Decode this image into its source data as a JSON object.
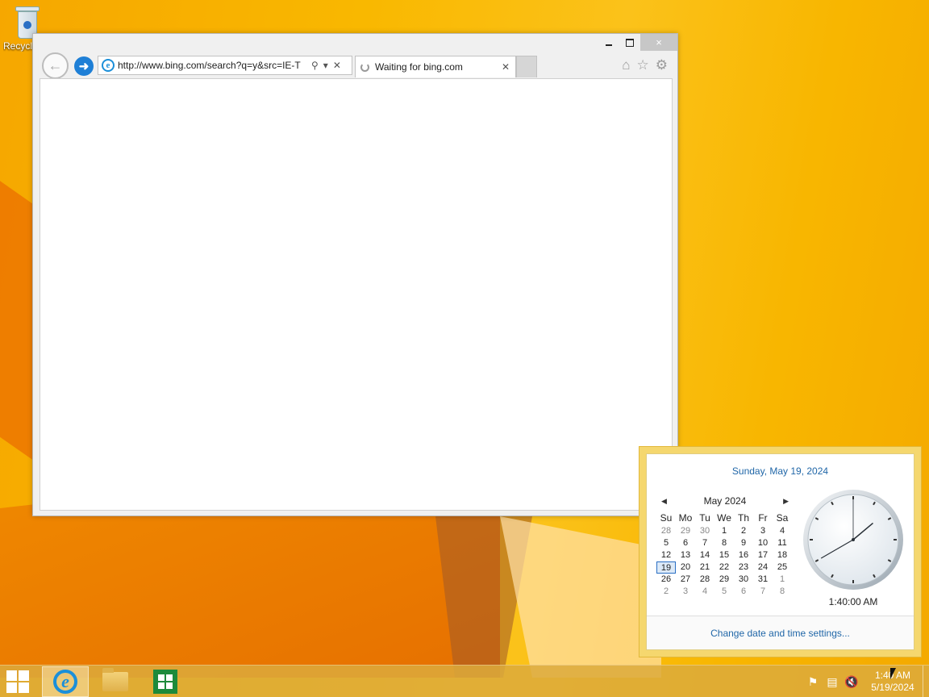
{
  "desktop": {
    "recycle_bin_label": "Recycle Bin"
  },
  "browser": {
    "address_url": "http://www.bing.com/search?q=y&src=IE-T",
    "tab_title": "Waiting for bing.com",
    "caption": {
      "minimize": "",
      "maximize": "",
      "close": "×"
    }
  },
  "flyout": {
    "full_date": "Sunday, May 19, 2024",
    "month_label": "May 2024",
    "weekdays": [
      "Su",
      "Mo",
      "Tu",
      "We",
      "Th",
      "Fr",
      "Sa"
    ],
    "days": [
      "28",
      "29",
      "30",
      "1",
      "2",
      "3",
      "4",
      "5",
      "6",
      "7",
      "8",
      "9",
      "10",
      "11",
      "12",
      "13",
      "14",
      "15",
      "16",
      "17",
      "18",
      "19",
      "20",
      "21",
      "22",
      "23",
      "24",
      "25",
      "26",
      "27",
      "28",
      "29",
      "30",
      "31",
      "1",
      "2",
      "3",
      "4",
      "5",
      "6",
      "7",
      "8"
    ],
    "other_month_indices": [
      0,
      1,
      2,
      34,
      35,
      36,
      37,
      38,
      39,
      40,
      41
    ],
    "today_index": 21,
    "time_label": "1:40:00 AM",
    "settings_link": "Change date and time settings..."
  },
  "taskbar": {
    "clock_time": "1:40 AM",
    "clock_date": "5/19/2024"
  },
  "colors": {
    "accent_blue": "#2167a8",
    "ie_blue": "#1b8fd9",
    "store_green": "#1d8a3b"
  }
}
